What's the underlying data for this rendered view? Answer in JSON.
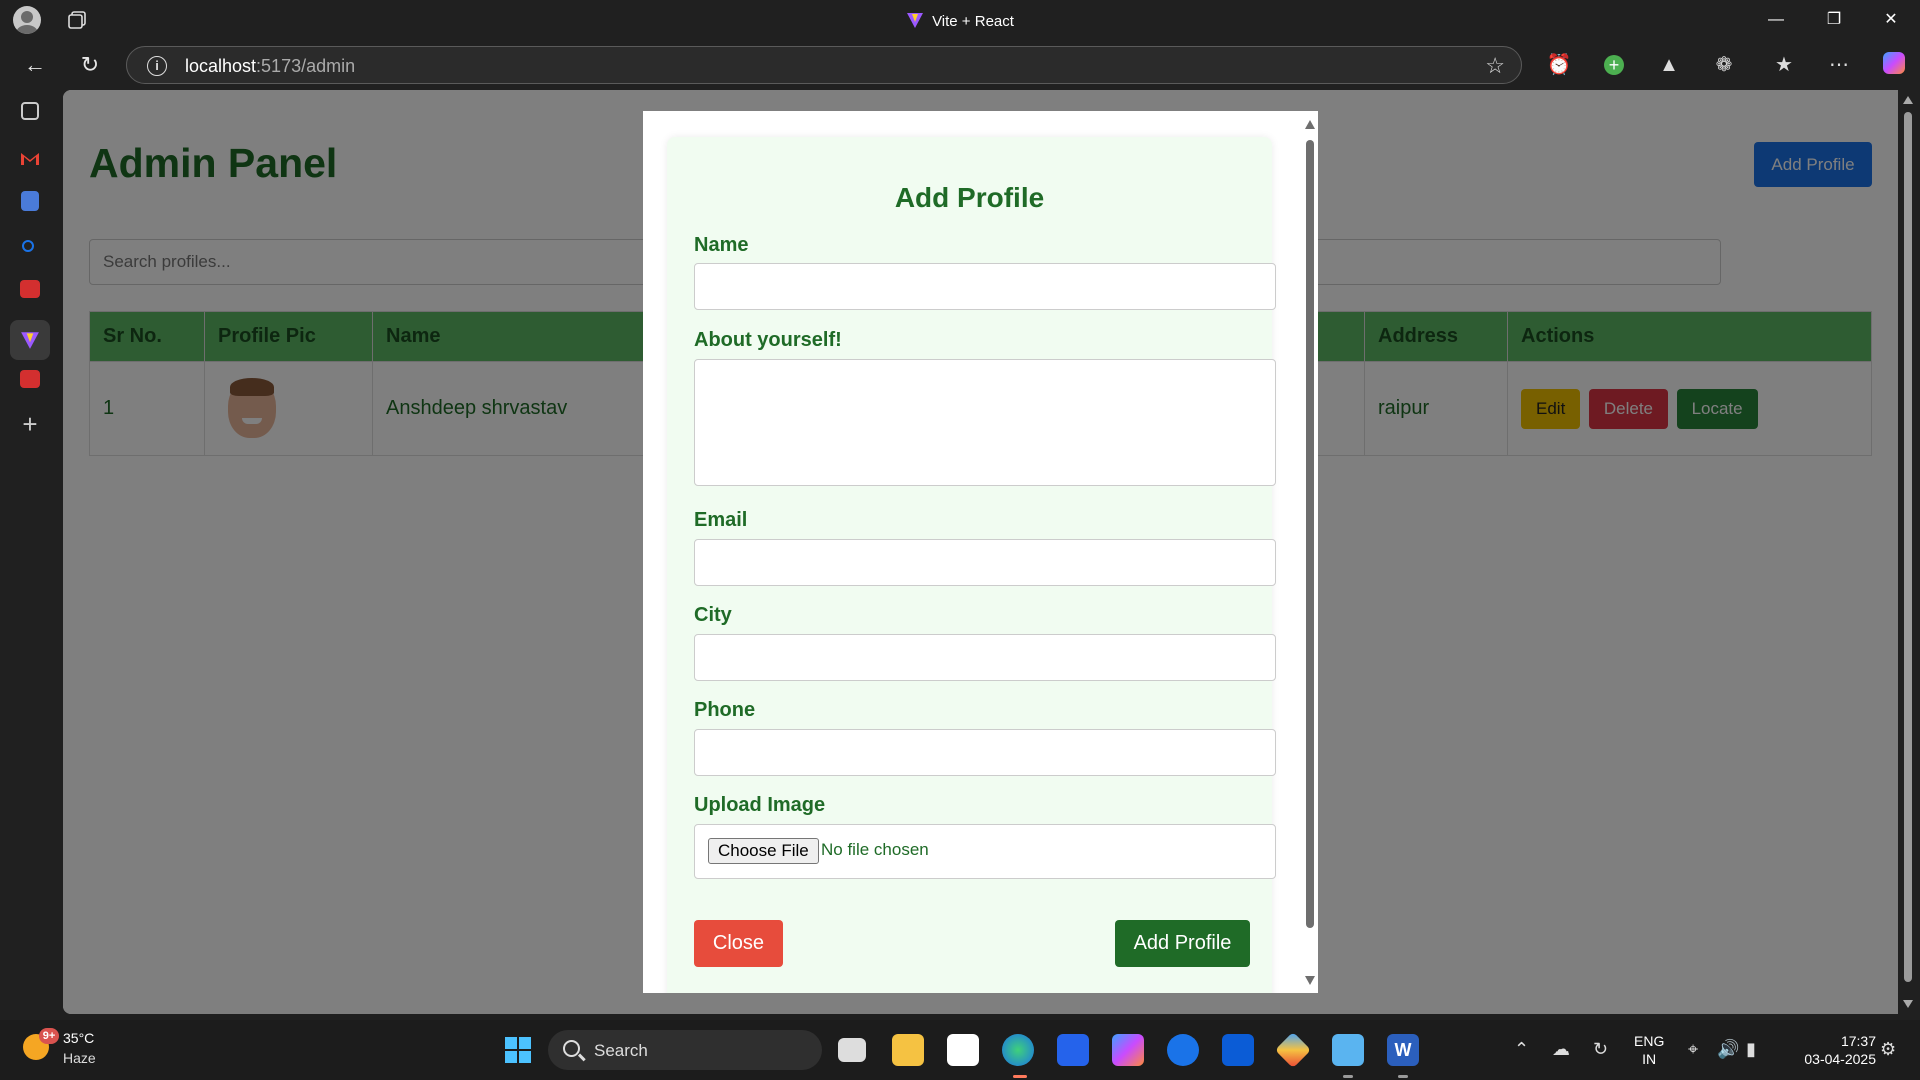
{
  "window": {
    "title": "Vite + React"
  },
  "browser": {
    "url_host": "localhost",
    "url_path": ":5173/admin"
  },
  "page": {
    "title": "Admin Panel",
    "add_profile_button": "Add Profile",
    "search_placeholder": "Search profiles...",
    "table": {
      "headers": [
        "Sr No.",
        "Profile Pic",
        "Name",
        "Address",
        "Actions"
      ],
      "rows": [
        {
          "sr": "1",
          "name": "Anshdeep shrvastav",
          "address": "raipur"
        }
      ],
      "actions": {
        "edit": "Edit",
        "delete": "Delete",
        "locate": "Locate"
      }
    }
  },
  "modal": {
    "title": "Add Profile",
    "fields": {
      "name": "Name",
      "about": "About yourself!",
      "email": "Email",
      "city": "City",
      "phone": "Phone",
      "image": "Upload Image"
    },
    "file": {
      "choose": "Choose File",
      "status": "No file chosen"
    },
    "close_button": "Close",
    "submit_button": "Add Profile"
  },
  "taskbar": {
    "weather_temp": "35°C",
    "weather_cond": "Haze",
    "weather_badge": "9+",
    "search_label": "Search",
    "lang_top": "ENG",
    "lang_bottom": "IN",
    "time": "17:37",
    "date": "03-04-2025"
  },
  "colors": {
    "accent_green": "#1f6b27",
    "table_header": "#5cb865",
    "primary_blue": "#1a73e8",
    "danger_red": "#dc3545",
    "close_red": "#e74c3c",
    "edit_yellow": "#f0c000"
  }
}
